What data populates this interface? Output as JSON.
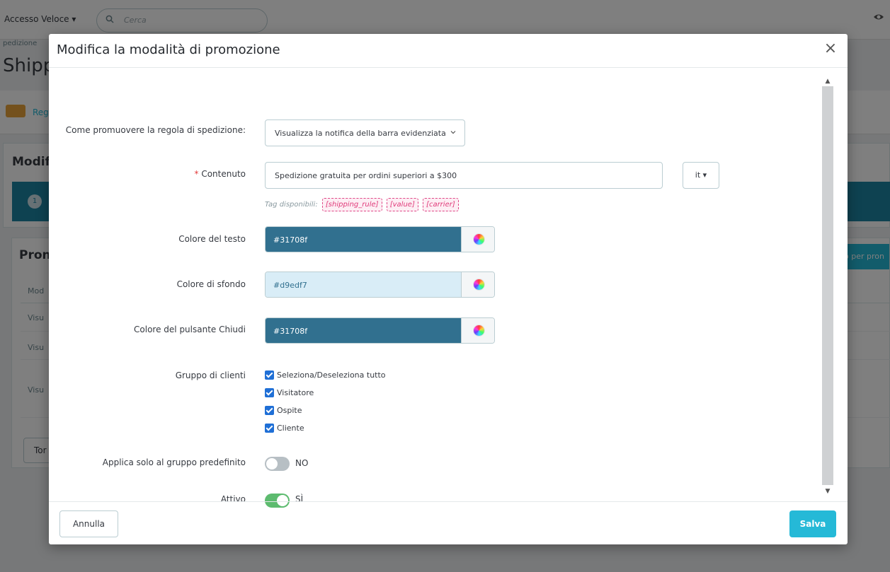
{
  "background": {
    "quick_access": "Accesso Veloce ▾",
    "search_placeholder": "Cerca",
    "breadcrumb": "pedizione",
    "page_title": "Shipp",
    "nav_text": "Reg",
    "card1_title": "Modif",
    "step_number": "1",
    "card2_title": "Pron",
    "card2_button": "o per pron",
    "table_header": "Mod",
    "row_text": [
      "Visu",
      "Visu",
      "Visu"
    ],
    "back_button": "Tor"
  },
  "modal": {
    "title": "Modifica la modalità di promozione",
    "fields": {
      "promote_label": "Come promuovere la regola di spedizione:",
      "promote_value": "Visualizza la notifica della barra evidenziata",
      "content_label": "Contenuto",
      "content_value": "Spedizione gratuita per ordini superiori a $300",
      "lang": "it ▾",
      "tags_label": "Tag disponibili:",
      "tags": [
        "[shipping_rule]",
        "[value]",
        "[carrier]"
      ],
      "text_color_label": "Colore del testo",
      "text_color": "#31708f",
      "bg_color_label": "Colore di sfondo",
      "bg_color": "#d9edf7",
      "close_color_label": "Colore del pulsante Chiudi",
      "close_color": "#31708f",
      "groups_label": "Gruppo di clienti",
      "groups": [
        "Seleziona/Deseleziona tutto",
        "Visitatore",
        "Ospite",
        "Cliente"
      ],
      "default_group_label": "Applica solo al gruppo predefinito",
      "default_group_state": "NO",
      "active_label": "Attivo",
      "active_state": "SÌ"
    },
    "footer": {
      "cancel": "Annulla",
      "save": "Salva"
    }
  },
  "colors": {
    "accent": "#25b9d7",
    "switch_on": "#5dbb6f",
    "checkbox": "#1f6fd6"
  },
  "icons": [
    "search-icon",
    "eye-icon",
    "close-icon",
    "chevron-down-icon",
    "color-wheel-icon",
    "checkbox-checked-icon",
    "scroll-up-icon",
    "scroll-down-icon"
  ]
}
